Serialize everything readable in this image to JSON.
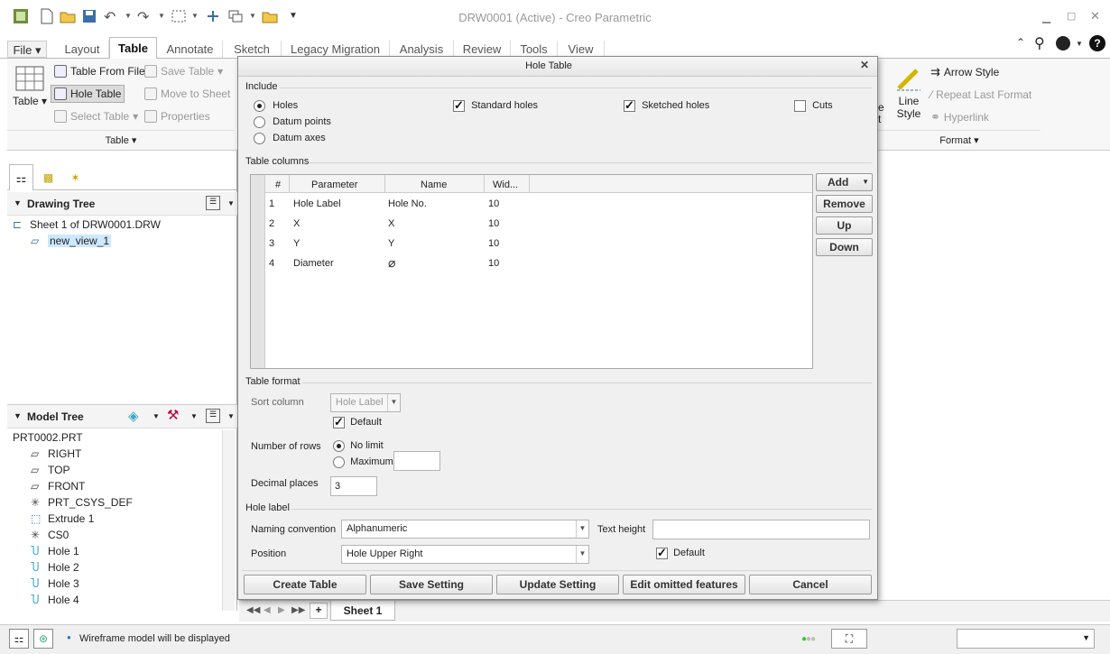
{
  "window": {
    "title": "DRW0001 (Active) - Creo Parametric"
  },
  "tabs": [
    "File",
    "Layout",
    "Table",
    "Annotate",
    "Sketch",
    "Legacy Migration",
    "Analysis",
    "Review",
    "Tools",
    "View"
  ],
  "ribbon": {
    "table_label": "Table",
    "table_from_file": "Table From File",
    "hole_table": "Hole Table",
    "select_table": "Select Table",
    "save_table": "Save Table",
    "move_to_sheet": "Move to Sheet",
    "properties": "Properties",
    "group_table": "Table",
    "arrow_style": "Arrow Style",
    "repeat_last_format": "Repeat Last Format",
    "hyperlink": "Hyperlink",
    "line_style_1": "Line",
    "line_style_2": "Style",
    "partial_e": "e",
    "partial_t": "t",
    "group_format": "Format"
  },
  "drawing_tree": {
    "title": "Drawing Tree",
    "sheet": "Sheet 1 of DRW0001.DRW",
    "view": "new_view_1"
  },
  "model_tree": {
    "title": "Model Tree",
    "items": [
      "PRT0002.PRT",
      "RIGHT",
      "TOP",
      "FRONT",
      "PRT_CSYS_DEF",
      "Extrude 1",
      "CS0",
      "Hole 1",
      "Hole 2",
      "Hole 3",
      "Hole 4"
    ]
  },
  "dialog": {
    "title": "Hole Table",
    "include_label": "Include",
    "holes": "Holes",
    "datum_points": "Datum points",
    "datum_axes": "Datum axes",
    "standard_holes": "Standard holes",
    "sketched_holes": "Sketched holes",
    "cuts": "Cuts",
    "table_columns_label": "Table columns",
    "columns_headers": [
      "#",
      "Parameter",
      "Name",
      "Wid..."
    ],
    "rows": [
      {
        "num": "1",
        "param": "Hole Label",
        "name": "Hole No.",
        "width": "10"
      },
      {
        "num": "2",
        "param": "X",
        "name": "X",
        "width": "10"
      },
      {
        "num": "3",
        "param": "Y",
        "name": "Y",
        "width": "10"
      },
      {
        "num": "4",
        "param": "Diameter",
        "name": "⌀",
        "width": "10"
      }
    ],
    "add": "Add",
    "remove": "Remove",
    "up": "Up",
    "down": "Down",
    "table_format_label": "Table format",
    "sort_column": "Sort column",
    "sort_value": "Hole Label",
    "default": "Default",
    "number_of_rows": "Number of rows",
    "no_limit": "No limit",
    "maximum": "Maximum",
    "decimal_places": "Decimal places",
    "decimal_value": "3",
    "hole_label_label": "Hole label",
    "naming_convention": "Naming convention",
    "naming_value": "Alphanumeric",
    "text_height": "Text height",
    "position": "Position",
    "position_value": "Hole Upper Right",
    "position_default": "Default",
    "create_table": "Create Table",
    "save_setting": "Save Setting",
    "update_setting": "Update Setting",
    "edit_omitted": "Edit omitted features",
    "cancel": "Cancel"
  },
  "sheet_tabs": {
    "sheet1": "Sheet 1",
    "add": "+"
  },
  "status": {
    "message": "Wireframe model will be displayed"
  }
}
